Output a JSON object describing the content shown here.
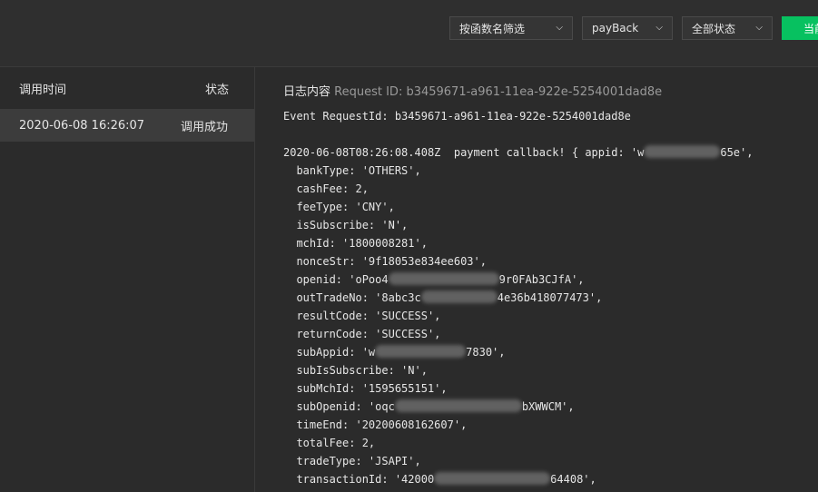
{
  "toolbar": {
    "filter_by_function": "按函数名筛选",
    "function_name": "payBack",
    "status_filter": "全部状态",
    "current_button": "当前"
  },
  "list": {
    "col_time": "调用时间",
    "col_status": "状态",
    "rows": [
      {
        "time": "2020-06-08 16:26:07",
        "status": "调用成功"
      }
    ]
  },
  "detail": {
    "title": "日志内容",
    "request_id_label": "Request ID: b3459671-a961-11ea-922e-5254001dad8e",
    "event_line": "Event RequestId: b3459671-a961-11ea-922e-5254001dad8e",
    "lines": {
      "l0a": "2020-06-08T08:26:08.408Z  payment callback! { appid: 'w",
      "l0b": "65e',",
      "l1": "  bankType: 'OTHERS',",
      "l2": "  cashFee: 2,",
      "l3": "  feeType: 'CNY',",
      "l4": "  isSubscribe: 'N',",
      "l5": "  mchId: '1800008281',",
      "l6": "  nonceStr: '9f18053e834ee603',",
      "l7a": "  openid: 'oPoo4",
      "l7b": "9r0FAb3CJfA',",
      "l8a": "  outTradeNo: '8abc3c",
      "l8b": "4e36b418077473',",
      "l9": "  resultCode: 'SUCCESS',",
      "l10": "  returnCode: 'SUCCESS',",
      "l11a": "  subAppid: 'w",
      "l11b": "7830',",
      "l12": "  subIsSubscribe: 'N',",
      "l13": "  subMchId: '1595655151',",
      "l14a": "  subOpenid: 'oqc",
      "l14b": "bXWWCM',",
      "l15": "  timeEnd: '20200608162607',",
      "l16": "  totalFee: 2,",
      "l17": "  tradeType: 'JSAPI',",
      "l18a": "  transactionId: '42000",
      "l18b": "64408',"
    }
  }
}
